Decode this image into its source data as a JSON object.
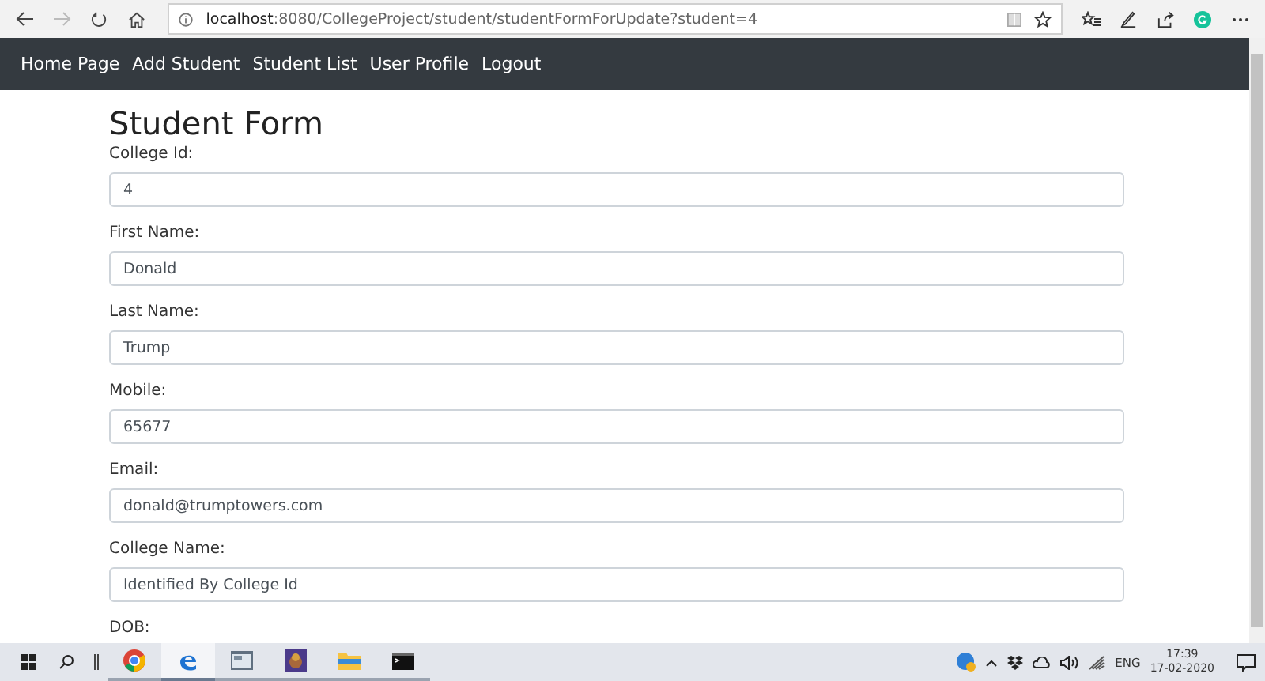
{
  "browser": {
    "url_host": "localhost",
    "url_rest": ":8080/CollegeProject/student/studentFormForUpdate?student=4"
  },
  "nav": [
    "Home Page",
    "Add Student",
    "Student List",
    "User Profile",
    "Logout"
  ],
  "form": {
    "title": "Student Form",
    "fields": [
      {
        "label": "College Id:",
        "value": "4"
      },
      {
        "label": "First Name:",
        "value": "Donald"
      },
      {
        "label": "Last Name:",
        "value": "Trump"
      },
      {
        "label": "Mobile:",
        "value": "65677"
      },
      {
        "label": "Email:",
        "value": "donald@trumptowers.com"
      },
      {
        "label": "College Name:",
        "value": "Identified By College Id"
      }
    ],
    "next_label": "DOB:"
  },
  "taskbar": {
    "apps": [
      {
        "kind": "chrome",
        "selected": false
      },
      {
        "kind": "edge",
        "selected": true
      },
      {
        "kind": "window",
        "selected": false
      },
      {
        "kind": "purple",
        "selected": false
      },
      {
        "kind": "folder",
        "selected": false
      },
      {
        "kind": "terminal",
        "selected": false
      }
    ],
    "language": "ENG",
    "time": "17:39",
    "date": "17-02-2020"
  }
}
